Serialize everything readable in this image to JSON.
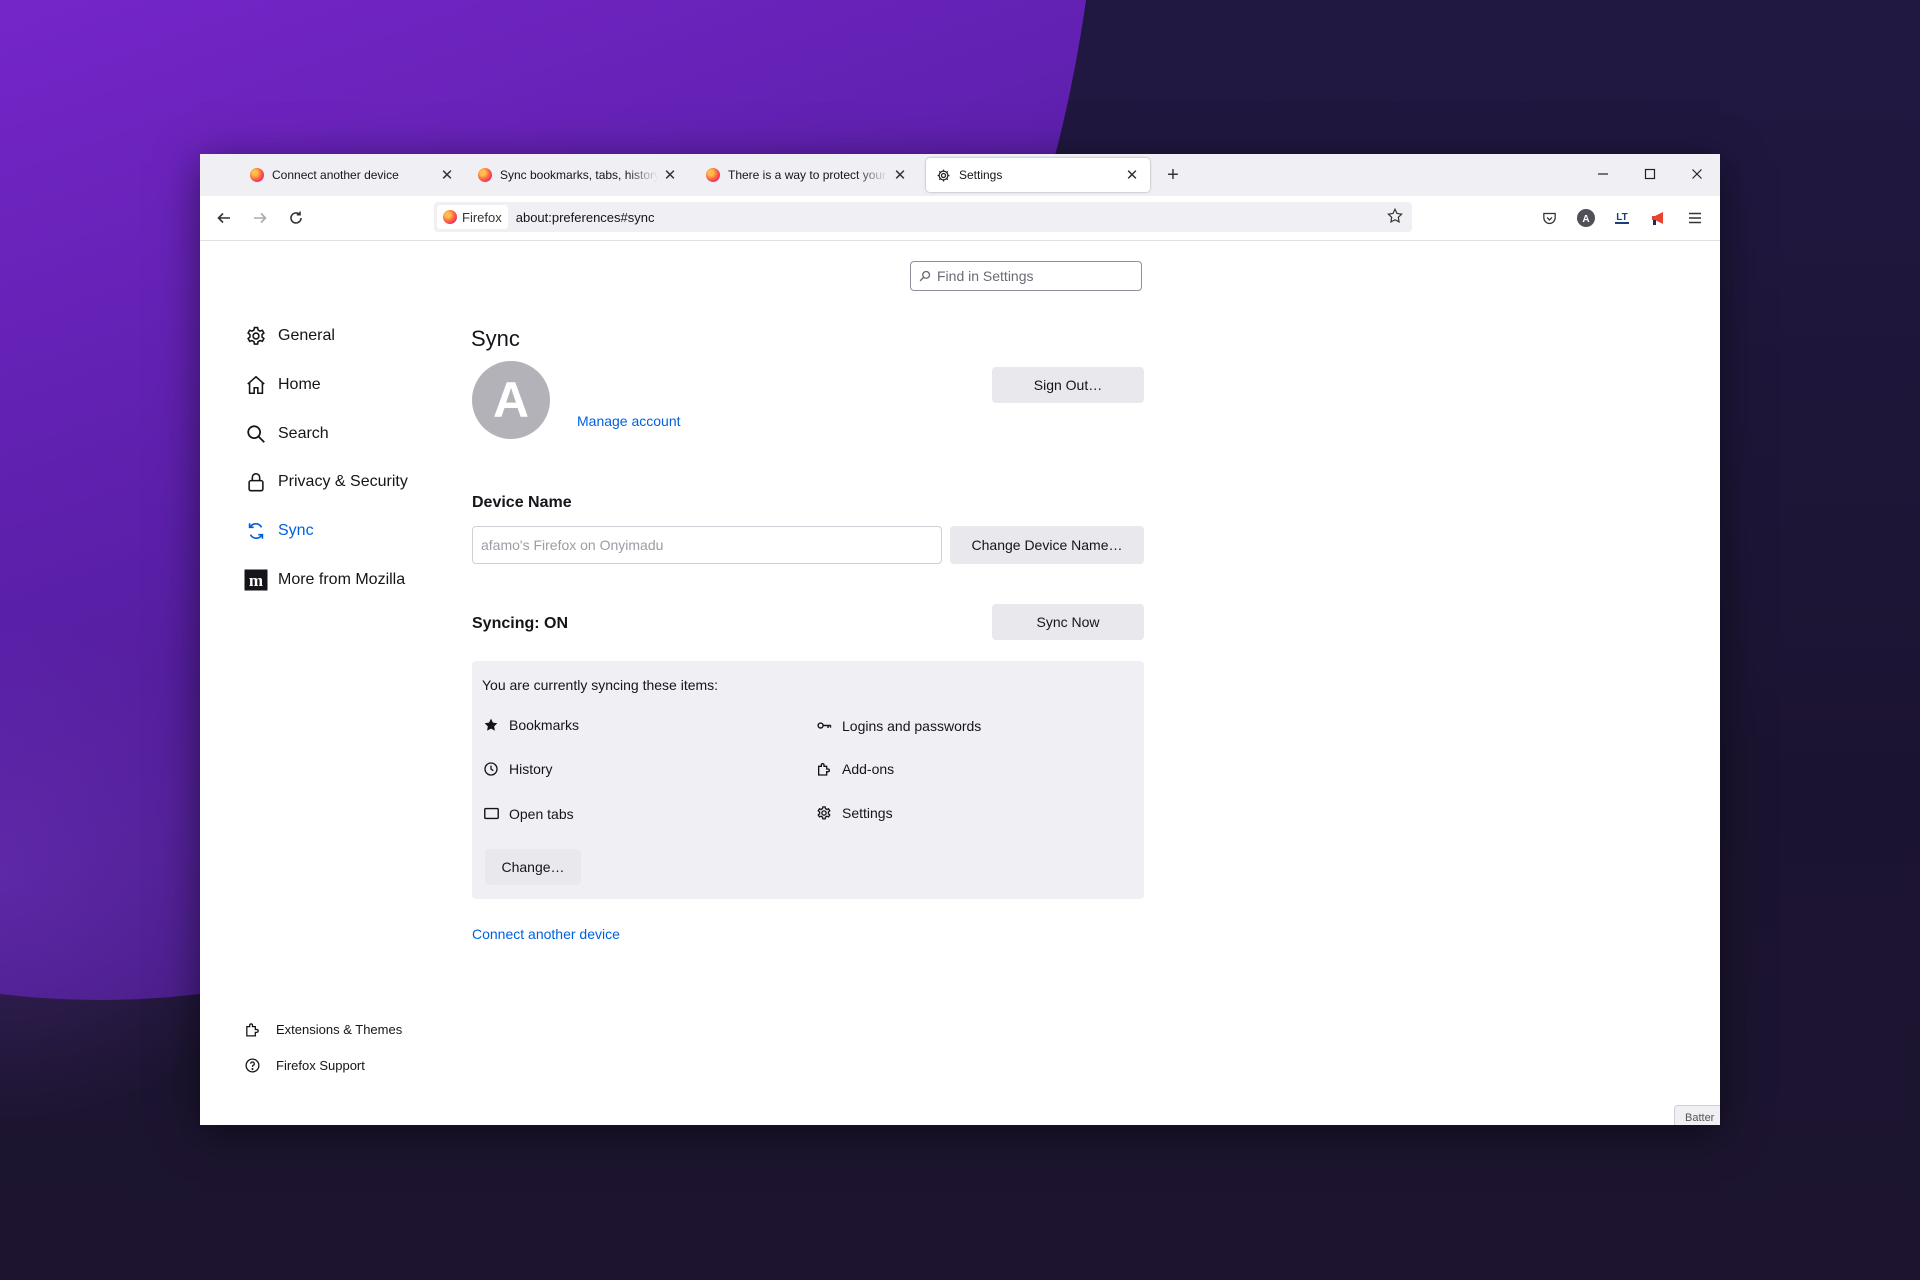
{
  "tabs": [
    {
      "title": "Connect another device"
    },
    {
      "title": "Sync bookmarks, tabs, history a"
    },
    {
      "title": "There is a way to protect your p"
    },
    {
      "title": "Settings"
    }
  ],
  "navbar": {
    "identity_label": "Firefox",
    "url": "about:preferences#sync"
  },
  "search": {
    "placeholder": "Find in Settings"
  },
  "sidebar": {
    "items": [
      {
        "label": "General",
        "icon": "gear-icon"
      },
      {
        "label": "Home",
        "icon": "home-icon"
      },
      {
        "label": "Search",
        "icon": "search-icon"
      },
      {
        "label": "Privacy & Security",
        "icon": "lock-icon"
      },
      {
        "label": "Sync",
        "icon": "sync-icon",
        "selected": true
      },
      {
        "label": "More from Mozilla",
        "icon": "mozilla-icon"
      }
    ],
    "footer": [
      {
        "label": "Extensions & Themes",
        "icon": "puzzle-icon"
      },
      {
        "label": "Firefox Support",
        "icon": "help-icon"
      }
    ]
  },
  "sync": {
    "title": "Sync",
    "avatar_letter": "A",
    "manage_account": "Manage account",
    "sign_out": "Sign Out…",
    "device_name_label": "Device Name",
    "device_name_value": "afamo's Firefox on Onyimadu",
    "change_device_name": "Change Device Name…",
    "status": "Syncing: ON",
    "sync_now": "Sync Now",
    "intro": "You are currently syncing these items:",
    "items_left": [
      {
        "label": "Bookmarks",
        "icon": "star-icon"
      },
      {
        "label": "History",
        "icon": "clock-icon"
      },
      {
        "label": "Open tabs",
        "icon": "tab-icon"
      }
    ],
    "items_right": [
      {
        "label": "Logins and passwords",
        "icon": "key-icon"
      },
      {
        "label": "Add-ons",
        "icon": "puzzle-icon"
      },
      {
        "label": "Settings",
        "icon": "gear-icon"
      }
    ],
    "change": "Change…",
    "connect_device": "Connect another device"
  },
  "corner_label": "Batter",
  "colors": {
    "accent": "#0061e0",
    "button_bg": "#e9e9ed",
    "tabstrip_bg": "#f0f0f4"
  }
}
